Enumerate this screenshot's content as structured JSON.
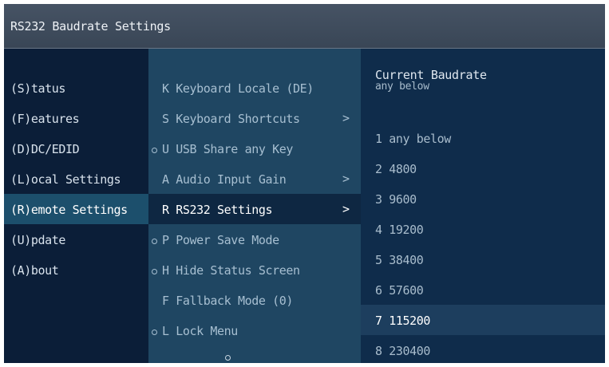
{
  "title": "RS232 Baudrate Settings",
  "main_menu": [
    {
      "label": "(S)tatus"
    },
    {
      "label": "(F)eatures"
    },
    {
      "label": "(D)DC/EDID"
    },
    {
      "label": "(L)ocal  Settings"
    },
    {
      "label": "(R)emote Settings",
      "selected": true
    },
    {
      "label": "(U)pdate"
    },
    {
      "label": "(A)bout"
    }
  ],
  "submenu": [
    {
      "label": "K Keyboard Locale (DE)",
      "dot": false,
      "arrow": ""
    },
    {
      "label": "S Keyboard Shortcuts",
      "dot": false,
      "arrow": ">"
    },
    {
      "label": "U USB Share any Key",
      "dot": true,
      "arrow": ""
    },
    {
      "label": "A Audio Input Gain",
      "dot": false,
      "arrow": ">"
    },
    {
      "label": "R RS232 Settings",
      "dot": false,
      "arrow": ">",
      "selected": true
    },
    {
      "label": "P Power Save Mode",
      "dot": true,
      "arrow": ""
    },
    {
      "label": "H Hide Status Screen",
      "dot": true,
      "arrow": ""
    },
    {
      "label": "F Fallback Mode (0)",
      "dot": false,
      "arrow": ""
    },
    {
      "label": "L Lock Menu",
      "dot": true,
      "arrow": ""
    }
  ],
  "baudrate": {
    "header": "Current Baudrate",
    "current": "any below",
    "options": [
      {
        "label": "1 any below"
      },
      {
        "label": "2 4800"
      },
      {
        "label": "3 9600"
      },
      {
        "label": "4 19200"
      },
      {
        "label": "5 38400"
      },
      {
        "label": "6 57600"
      },
      {
        "label": "7 115200",
        "selected": true
      },
      {
        "label": "8 230400"
      }
    ]
  },
  "colors": {
    "background": "#0d2542",
    "selected": "#1c4f6c",
    "submenu_bg": "#1f4662"
  }
}
